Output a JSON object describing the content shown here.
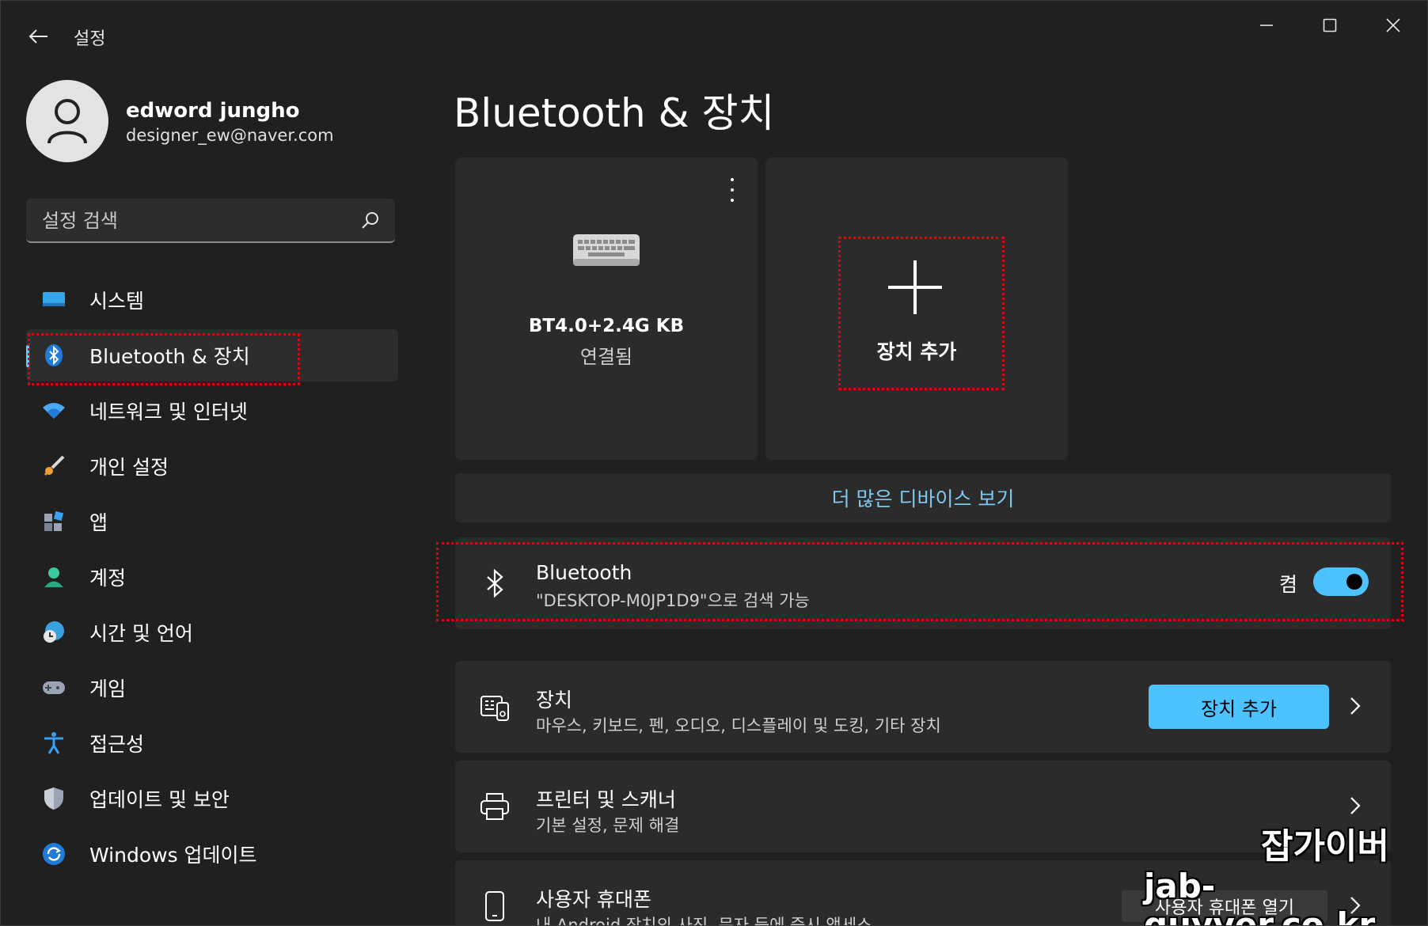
{
  "window": {
    "title": "설정"
  },
  "profile": {
    "name": "edword jungho",
    "email": "designer_ew@naver.com"
  },
  "search": {
    "placeholder": "설정 검색"
  },
  "sidebar": {
    "items": [
      {
        "label": "시스템",
        "icon": "system-icon"
      },
      {
        "label": "Bluetooth & 장치",
        "icon": "bluetooth-icon",
        "active": true
      },
      {
        "label": "네트워크 및 인터넷",
        "icon": "wifi-icon"
      },
      {
        "label": "개인 설정",
        "icon": "brush-icon"
      },
      {
        "label": "앱",
        "icon": "apps-icon"
      },
      {
        "label": "계정",
        "icon": "account-icon"
      },
      {
        "label": "시간 및 언어",
        "icon": "globe-clock-icon"
      },
      {
        "label": "게임",
        "icon": "gamepad-icon"
      },
      {
        "label": "접근성",
        "icon": "accessibility-icon"
      },
      {
        "label": "업데이트 및 보안",
        "icon": "shield-icon"
      },
      {
        "label": "Windows 업데이트",
        "icon": "refresh-icon"
      }
    ]
  },
  "main": {
    "title": "Bluetooth & 장치",
    "device_card": {
      "name": "BT4.0+2.4G KB",
      "status": "연결됨"
    },
    "add_card": {
      "label": "장치 추가"
    },
    "more_devices": "더 많은 디바이스 보기",
    "bluetooth_row": {
      "title": "Bluetooth",
      "subtitle": "\"DESKTOP-M0JP1D9\"으로 검색 가능",
      "toggle_label": "켬",
      "on": true
    },
    "devices_row": {
      "title": "장치",
      "subtitle": "마우스, 키보드, 펜, 오디오, 디스플레이 및 도킹, 기타 장치",
      "button": "장치 추가"
    },
    "printers_row": {
      "title": "프린터 및 스캐너",
      "subtitle": "기본 설정, 문제 해결"
    },
    "phone_row": {
      "title": "사용자 휴대폰",
      "subtitle": "내 Android 장치의 사진, 문자 등에 즉시 액세스",
      "button": "사용자 휴대폰 열기"
    }
  },
  "watermark": {
    "line1": "잡가이버",
    "line2": "jab-guyver.co.kr"
  },
  "colors": {
    "accent": "#4cc2ff",
    "link": "#7ec8ef",
    "highlight_box": "#e0000f",
    "background": "#202020",
    "card": "#2b2b2b"
  }
}
